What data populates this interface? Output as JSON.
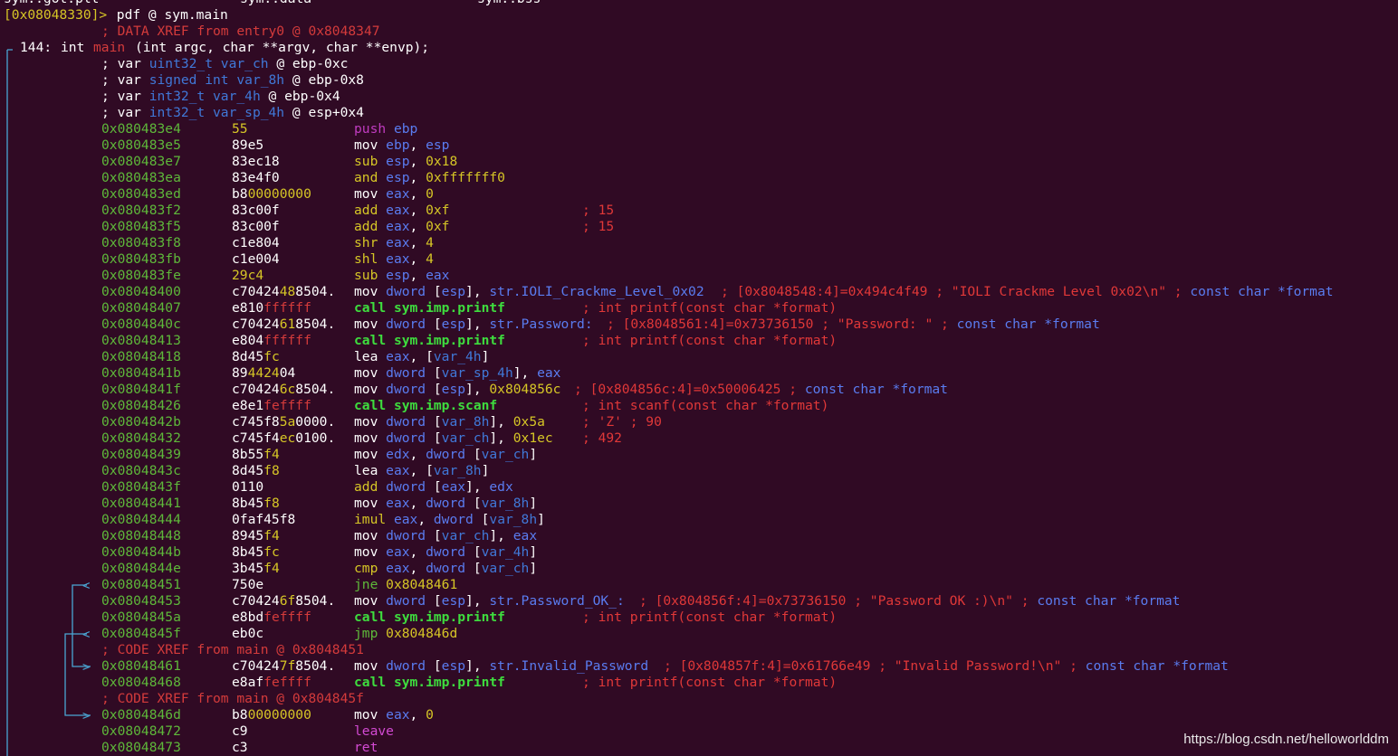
{
  "terminal": {
    "topbar": {
      "left": "sym..got.plt",
      "mid": "sym..data",
      "right": "sym..bss"
    },
    "prompt": "[0x08048330]>",
    "command": " pdf @ sym.main",
    "xref_entry": "; DATA XREF from entry0 @ 0x8048347",
    "func_size": "144:",
    "func_type": "int",
    "func_name": "main",
    "func_args": "(int argc, char **argv, char **envp);",
    "vars": [
      {
        "kw": "; var ",
        "type": "uint32_t",
        "name": "var_ch",
        "loc": "@ ebp-0xc"
      },
      {
        "kw": "; var ",
        "type": "signed int",
        "name": "var_8h",
        "loc": "@ ebp-0x8"
      },
      {
        "kw": "; var ",
        "type": "int32_t",
        "name": "var_4h",
        "loc": "@ ebp-0x4"
      },
      {
        "kw": "; var ",
        "type": "int32_t",
        "name": "var_sp_4h",
        "loc": "@ esp+0x4"
      }
    ],
    "instructions": [
      {
        "addr": "0x080483e4",
        "bytes": "55",
        "mnem": "push",
        "ops": "ebp",
        "comment": ""
      },
      {
        "addr": "0x080483e5",
        "bytes": "89e5",
        "mnem": "mov",
        "ops": "ebp, esp",
        "comment": ""
      },
      {
        "addr": "0x080483e7",
        "bytes": "83ec18",
        "mnem": "sub",
        "ops": "esp, 0x18",
        "comment": ""
      },
      {
        "addr": "0x080483ea",
        "bytes": "83e4f0",
        "mnem": "and",
        "ops": "esp, 0xfffffff0",
        "comment": ""
      },
      {
        "addr": "0x080483ed",
        "bytes": "b800000000",
        "mnem": "mov",
        "ops": "eax, 0",
        "comment": ""
      },
      {
        "addr": "0x080483f2",
        "bytes": "83c00f",
        "mnem": "add",
        "ops": "eax, 0xf",
        "comment": "; 15"
      },
      {
        "addr": "0x080483f5",
        "bytes": "83c00f",
        "mnem": "add",
        "ops": "eax, 0xf",
        "comment": "; 15"
      },
      {
        "addr": "0x080483f8",
        "bytes": "c1e804",
        "mnem": "shr",
        "ops": "eax, 4",
        "comment": ""
      },
      {
        "addr": "0x080483fb",
        "bytes": "c1e004",
        "mnem": "shl",
        "ops": "eax, 4",
        "comment": ""
      },
      {
        "addr": "0x080483fe",
        "bytes": "29c4",
        "mnem": "sub",
        "ops": "esp, eax",
        "comment": ""
      },
      {
        "addr": "0x08048400",
        "bytes": "c70424488504.",
        "mnem": "mov",
        "ops": "dword [esp], str.IOLI_Crackme_Level_0x02",
        "comment": "; [0x8048548:4]=0x494c4f49 ; \"IOLI Crackme Level 0x02\\n\" ; const char *format"
      },
      {
        "addr": "0x08048407",
        "bytes": "e810ffffff",
        "mnem": "call",
        "ops": "sym.imp.printf",
        "comment": "; int printf(const char *format)"
      },
      {
        "addr": "0x0804840c",
        "bytes": "c70424618504.",
        "mnem": "mov",
        "ops": "dword [esp], str.Password:",
        "comment": "; [0x8048561:4]=0x73736150 ; \"Password: \" ; const char *format"
      },
      {
        "addr": "0x08048413",
        "bytes": "e804ffffff",
        "mnem": "call",
        "ops": "sym.imp.printf",
        "comment": "; int printf(const char *format)"
      },
      {
        "addr": "0x08048418",
        "bytes": "8d45fc",
        "mnem": "lea",
        "ops": "eax, [var_4h]",
        "comment": ""
      },
      {
        "addr": "0x0804841b",
        "bytes": "89442404",
        "mnem": "mov",
        "ops": "dword [var_sp_4h], eax",
        "comment": ""
      },
      {
        "addr": "0x0804841f",
        "bytes": "c704246c8504.",
        "mnem": "mov",
        "ops": "dword [esp], 0x804856c",
        "comment": "; [0x804856c:4]=0x50006425 ; const char *format"
      },
      {
        "addr": "0x08048426",
        "bytes": "e8e1feffff",
        "mnem": "call",
        "ops": "sym.imp.scanf",
        "comment": "; int scanf(const char *format)"
      },
      {
        "addr": "0x0804842b",
        "bytes": "c745f85a0000.",
        "mnem": "mov",
        "ops": "dword [var_8h], 0x5a",
        "comment": "; 'Z' ; 90"
      },
      {
        "addr": "0x08048432",
        "bytes": "c745f4ec0100.",
        "mnem": "mov",
        "ops": "dword [var_ch], 0x1ec",
        "comment": "; 492"
      },
      {
        "addr": "0x08048439",
        "bytes": "8b55f4",
        "mnem": "mov",
        "ops": "edx, dword [var_ch]",
        "comment": ""
      },
      {
        "addr": "0x0804843c",
        "bytes": "8d45f8",
        "mnem": "lea",
        "ops": "eax, [var_8h]",
        "comment": ""
      },
      {
        "addr": "0x0804843f",
        "bytes": "0110",
        "mnem": "add",
        "ops": "dword [eax], edx",
        "comment": ""
      },
      {
        "addr": "0x08048441",
        "bytes": "8b45f8",
        "mnem": "mov",
        "ops": "eax, dword [var_8h]",
        "comment": ""
      },
      {
        "addr": "0x08048444",
        "bytes": "0faf45f8",
        "mnem": "imul",
        "ops": "eax, dword [var_8h]",
        "comment": ""
      },
      {
        "addr": "0x08048448",
        "bytes": "8945f4",
        "mnem": "mov",
        "ops": "dword [var_ch], eax",
        "comment": ""
      },
      {
        "addr": "0x0804844b",
        "bytes": "8b45fc",
        "mnem": "mov",
        "ops": "eax, dword [var_4h]",
        "comment": ""
      },
      {
        "addr": "0x0804844e",
        "bytes": "3b45f4",
        "mnem": "cmp",
        "ops": "eax, dword [var_ch]",
        "comment": ""
      },
      {
        "addr": "0x08048451",
        "bytes": "750e",
        "mnem": "jne",
        "ops": "0x8048461",
        "comment": ""
      },
      {
        "addr": "0x08048453",
        "bytes": "c704246f8504.",
        "mnem": "mov",
        "ops": "dword [esp], str.Password_OK_:",
        "comment": "; [0x804856f:4]=0x73736150 ; \"Password OK :)\\n\" ; const char *format"
      },
      {
        "addr": "0x0804845a",
        "bytes": "e8bdfeffff",
        "mnem": "call",
        "ops": "sym.imp.printf",
        "comment": "; int printf(const char *format)"
      },
      {
        "addr": "0x0804845f",
        "bytes": "eb0c",
        "mnem": "jmp",
        "ops": "0x804846d",
        "comment": ""
      },
      {
        "xref": "; CODE XREF from main @ 0x8048451"
      },
      {
        "addr": "0x08048461",
        "bytes": "c704247f8504.",
        "mnem": "mov",
        "ops": "dword [esp], str.Invalid_Password",
        "comment": "; [0x804857f:4]=0x61766e49 ; \"Invalid Password!\\n\" ; const char *format"
      },
      {
        "addr": "0x08048468",
        "bytes": "e8affeffff",
        "mnem": "call",
        "ops": "sym.imp.printf",
        "comment": "; int printf(const char *format)"
      },
      {
        "xref": "; CODE XREF from main @ 0x804845f"
      },
      {
        "addr": "0x0804846d",
        "bytes": "b800000000",
        "mnem": "mov",
        "ops": "eax, 0",
        "comment": ""
      },
      {
        "addr": "0x08048472",
        "bytes": "c9",
        "mnem": "leave",
        "ops": "",
        "comment": ""
      },
      {
        "addr": "0x08048473",
        "bytes": "c3",
        "mnem": "ret",
        "ops": "",
        "comment": ""
      }
    ]
  },
  "watermark": "https://blog.csdn.net/helloworlddm",
  "colors": {
    "background": "#300a24",
    "address": "#5eb83a",
    "bytes_highlight": "#d6c626",
    "comment": "#e03838",
    "register": "#5a7cf0",
    "call": "#3edd3e",
    "leave_ret": "#d24ad2"
  }
}
